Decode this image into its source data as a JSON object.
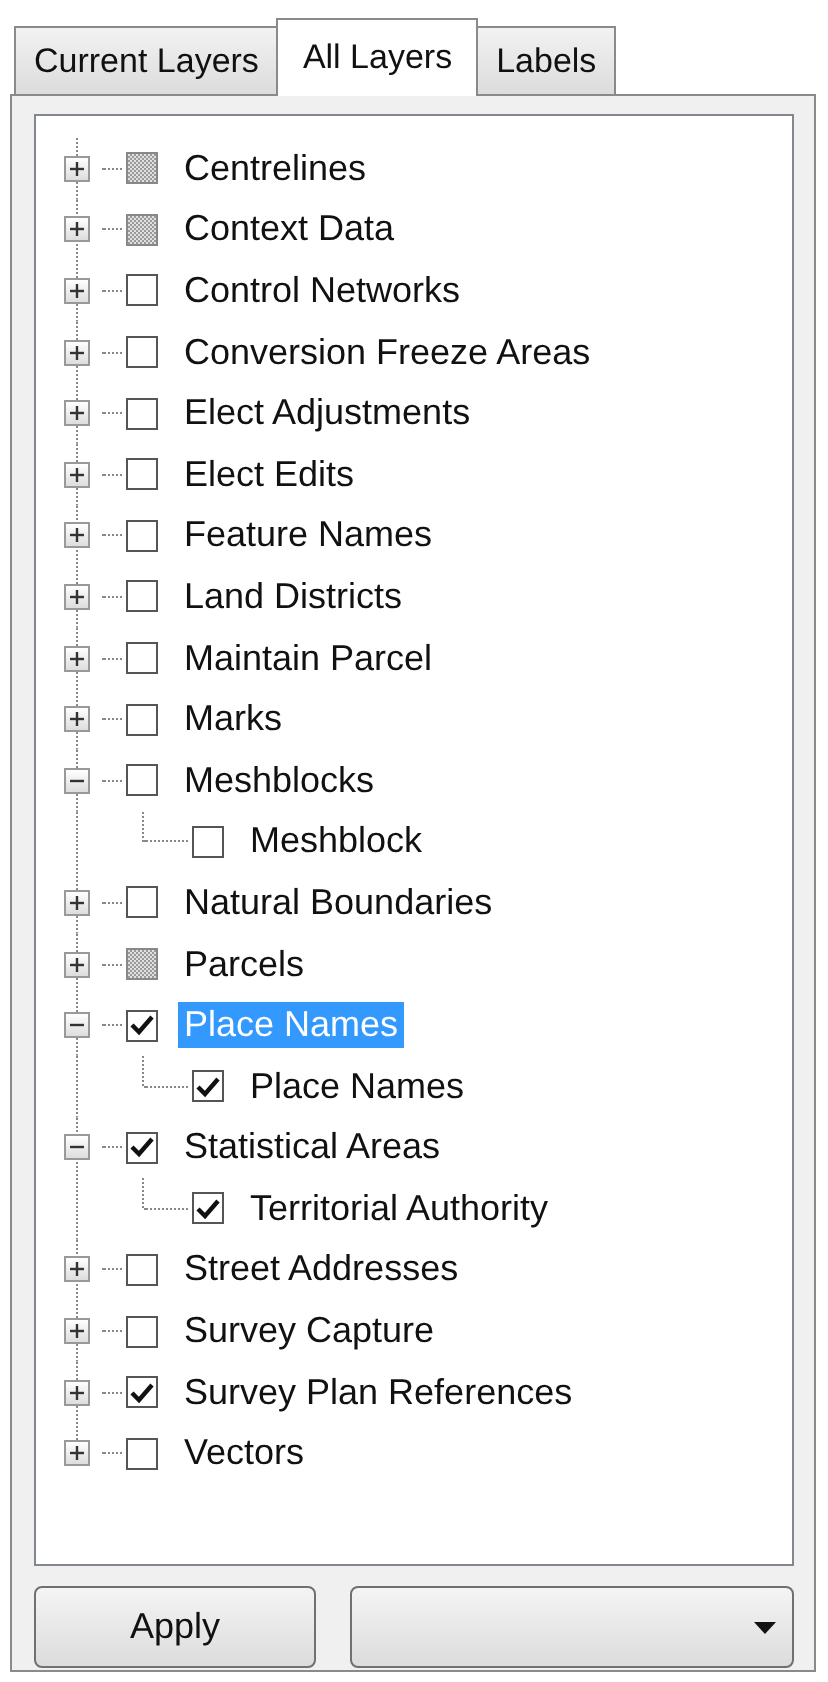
{
  "tabs": [
    {
      "label": "Current Layers",
      "selected": false
    },
    {
      "label": "All Layers",
      "selected": true
    },
    {
      "label": "Labels",
      "selected": false
    }
  ],
  "layers": [
    {
      "label": "Centrelines",
      "checked": false,
      "indeterminate": true,
      "expanded": false,
      "selected": false
    },
    {
      "label": "Context Data",
      "checked": false,
      "indeterminate": true,
      "expanded": false,
      "selected": false
    },
    {
      "label": "Control Networks",
      "checked": false,
      "indeterminate": false,
      "expanded": false,
      "selected": false
    },
    {
      "label": "Conversion Freeze Areas",
      "checked": false,
      "indeterminate": false,
      "expanded": false,
      "selected": false
    },
    {
      "label": "Elect Adjustments",
      "checked": false,
      "indeterminate": false,
      "expanded": false,
      "selected": false
    },
    {
      "label": "Elect Edits",
      "checked": false,
      "indeterminate": false,
      "expanded": false,
      "selected": false
    },
    {
      "label": "Feature Names",
      "checked": false,
      "indeterminate": false,
      "expanded": false,
      "selected": false
    },
    {
      "label": "Land Districts",
      "checked": false,
      "indeterminate": false,
      "expanded": false,
      "selected": false
    },
    {
      "label": "Maintain Parcel",
      "checked": false,
      "indeterminate": false,
      "expanded": false,
      "selected": false
    },
    {
      "label": "Marks",
      "checked": false,
      "indeterminate": false,
      "expanded": false,
      "selected": false
    },
    {
      "label": "Meshblocks",
      "checked": false,
      "indeterminate": false,
      "expanded": true,
      "selected": false,
      "children": [
        {
          "label": "Meshblock",
          "checked": false,
          "selected": false
        }
      ]
    },
    {
      "label": "Natural Boundaries",
      "checked": false,
      "indeterminate": false,
      "expanded": false,
      "selected": false
    },
    {
      "label": "Parcels",
      "checked": false,
      "indeterminate": true,
      "expanded": false,
      "selected": false
    },
    {
      "label": "Place Names",
      "checked": true,
      "indeterminate": false,
      "expanded": true,
      "selected": true,
      "children": [
        {
          "label": "Place Names",
          "checked": true,
          "selected": false
        }
      ]
    },
    {
      "label": "Statistical Areas",
      "checked": true,
      "indeterminate": false,
      "expanded": true,
      "selected": false,
      "children": [
        {
          "label": "Territorial Authority",
          "checked": true,
          "selected": false
        }
      ]
    },
    {
      "label": "Street Addresses",
      "checked": false,
      "indeterminate": false,
      "expanded": false,
      "selected": false
    },
    {
      "label": "Survey Capture",
      "checked": false,
      "indeterminate": false,
      "expanded": false,
      "selected": false
    },
    {
      "label": "Survey Plan References",
      "checked": true,
      "indeterminate": false,
      "expanded": false,
      "selected": false
    },
    {
      "label": "Vectors",
      "checked": false,
      "indeterminate": false,
      "expanded": false,
      "selected": false
    }
  ],
  "apply_button": "Apply"
}
